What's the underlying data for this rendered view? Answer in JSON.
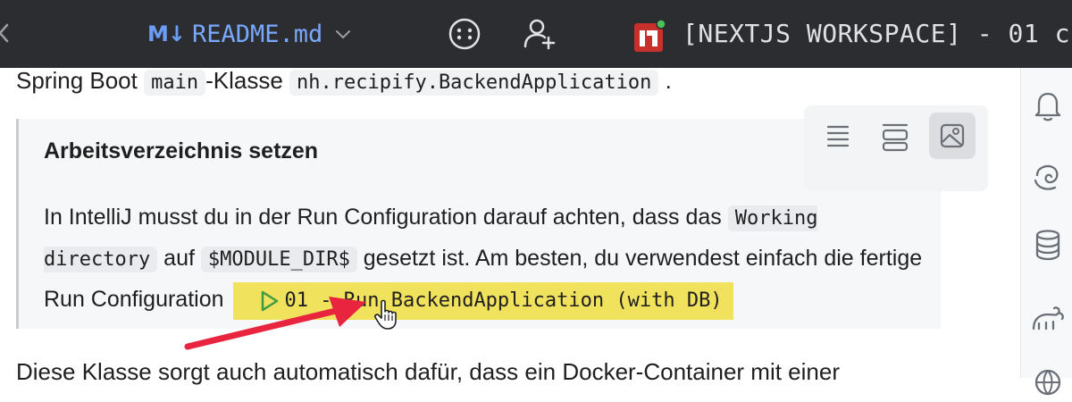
{
  "titlebar": {
    "file_tab": {
      "icon_text": "M↓",
      "name": "README.md"
    },
    "project_title": "[NEXTJS WORKSPACE] - 01 c",
    "colors": {
      "background": "#2b2d30",
      "file_name": "#79a8ff",
      "badge_red": "#c8302c",
      "badge_dot": "#4cc35a"
    }
  },
  "doc": {
    "line1": {
      "prefix": "Spring Boot ",
      "code1": "main",
      "middle": "-Klasse ",
      "code2": "nh.recipify.BackendApplication",
      "suffix": " ."
    },
    "callout": {
      "title": "Arbeitsverzeichnis setzen",
      "body": {
        "part1": "In IntelliJ musst du in der Run Configuration darauf achten, dass das ",
        "code1": "Working directory",
        "part2": " auf ",
        "code2": "$MODULE_DIR$",
        "part3": " gesetzt ist. Am besten, du verwendest einfach die fertige Run Configuration",
        "run_config": "01 - Run BackendApplication (with DB)"
      }
    },
    "line2": "Diese Klasse sorgt auch automatisch dafür, dass ein Docker-Container mit einer"
  },
  "view_toolbar": {
    "icons": [
      "list-view-icon",
      "split-view-icon",
      "preview-view-icon"
    ],
    "active": "preview-view-icon"
  },
  "right_strip": {
    "icons": [
      "notifications-icon",
      "swirl-icon",
      "database-icon",
      "gradle-icon",
      "globe-icon"
    ]
  },
  "colors": {
    "highlight": "#f1e25d",
    "arrow": "#e8243e",
    "play": "#3f9b3f"
  }
}
